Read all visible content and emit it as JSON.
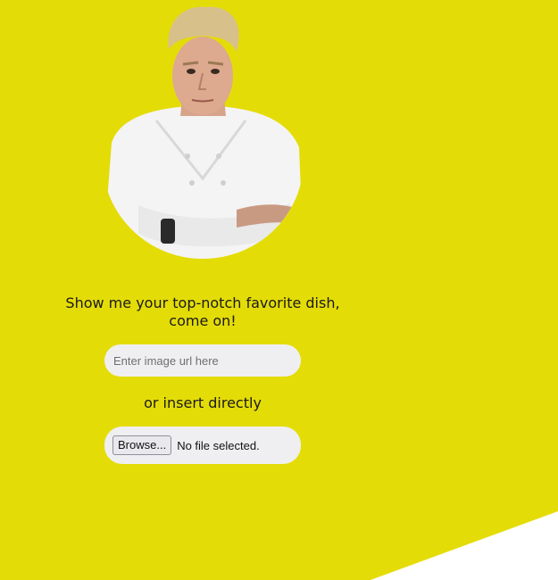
{
  "theme": {
    "background": "#e4dc07",
    "corner": "#ffffff"
  },
  "portrait": {
    "icon": "chef-portrait"
  },
  "prompt": {
    "text": "Show me your top-notch favorite dish, come on!"
  },
  "url_input": {
    "placeholder": "Enter image url here",
    "value": ""
  },
  "or_text": "or insert directly",
  "file_input": {
    "button_label": "Browse...",
    "status": "No file selected."
  }
}
